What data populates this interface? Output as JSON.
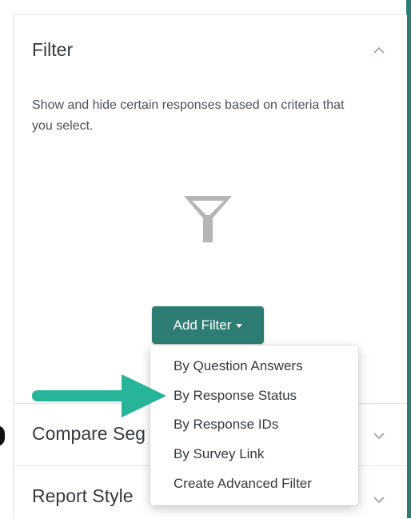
{
  "filter_section": {
    "title": "Filter",
    "description": "Show and hide certain responses based on criteria that you select.",
    "add_button_label": "Add Filter",
    "dropdown": [
      {
        "label": "By Question Answers"
      },
      {
        "label": "By Response Status"
      },
      {
        "label": "By Response IDs"
      },
      {
        "label": "By Survey Link"
      },
      {
        "label": "Create Advanced Filter"
      }
    ]
  },
  "compare_section": {
    "title_visible": "Compare Seg"
  },
  "report_style_section": {
    "title": "Report Style"
  },
  "colors": {
    "accent": "#2e7d74",
    "arrow": "#27b59a",
    "icon_gray": "#b5b5b5",
    "text": "#333a40"
  },
  "icons": [
    "chevron-up-icon",
    "funnel-icon",
    "caret-down-icon",
    "chevron-down-icon",
    "arrow-right-icon"
  ]
}
